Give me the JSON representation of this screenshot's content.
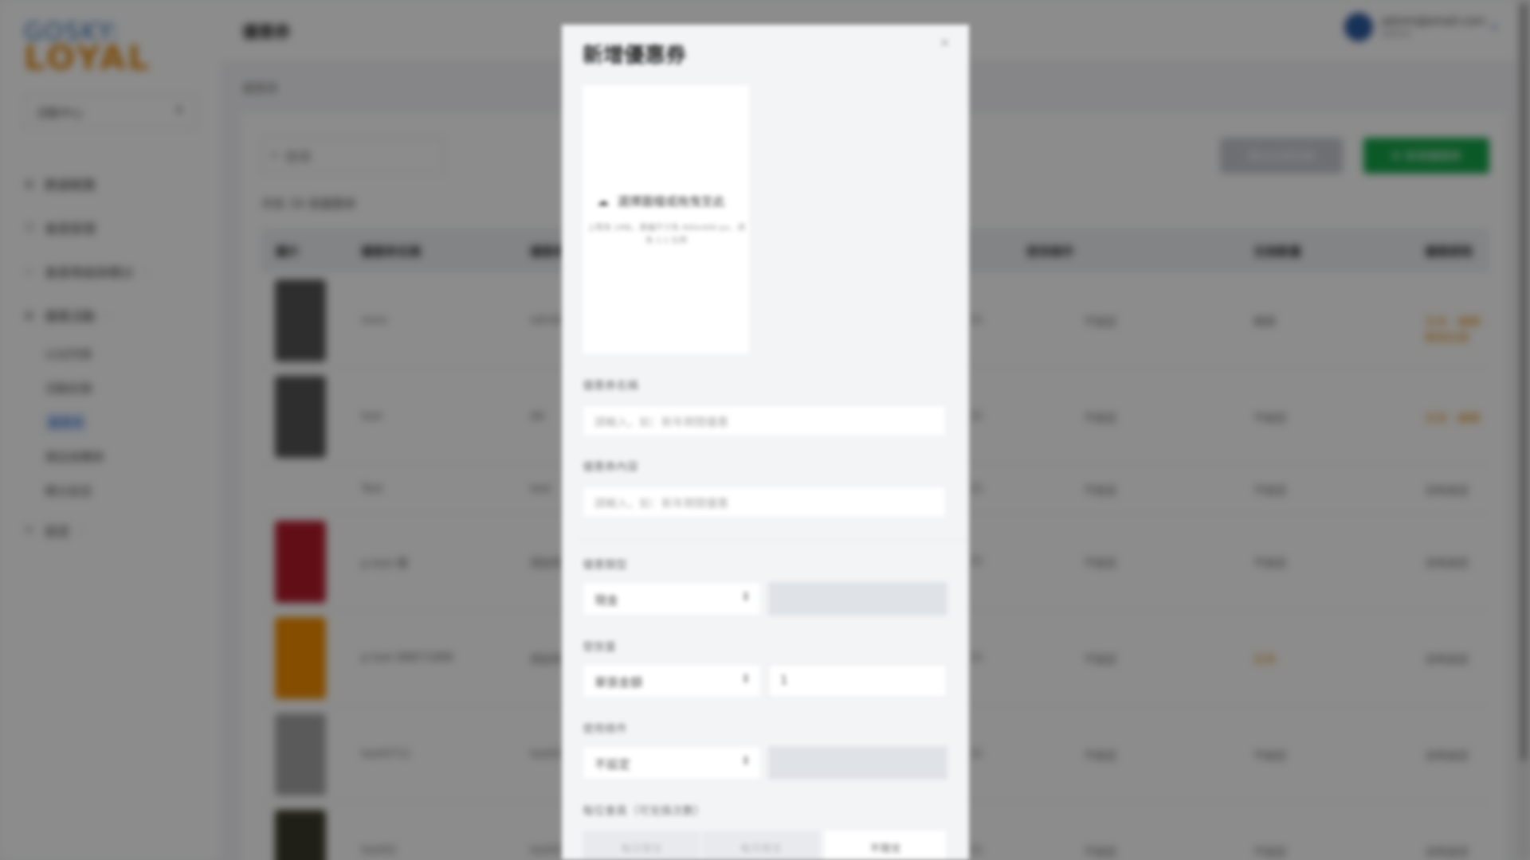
{
  "brand": {
    "logo_top": "GOSKY:",
    "logo_bottom": "LOYAL"
  },
  "sidebar": {
    "store_select": "活動中心",
    "items": [
      {
        "icon": "grid-icon",
        "label": "數據概覽"
      },
      {
        "icon": "users-icon",
        "label": "會員管理"
      },
      {
        "icon": "message-icon",
        "label": "會員等級與積分",
        "chevron": "›"
      },
      {
        "icon": "gift-icon",
        "label": "優惠活動",
        "chevron": "›"
      }
    ],
    "subitems": [
      {
        "label": "以往列表"
      },
      {
        "label": "活動紀錄"
      },
      {
        "label": "優惠券",
        "active": true
      },
      {
        "label": "禮品換購表"
      },
      {
        "label": "積分設定"
      }
    ],
    "settings": {
      "icon": "gear-icon",
      "label": "設定",
      "chevron": "›"
    }
  },
  "header": {
    "title": "優惠券",
    "user": {
      "email": "admin@email.com",
      "role": "Admin",
      "caret": "▾"
    }
  },
  "breadcrumb": "優惠券",
  "toolbar": {
    "search_placeholder": "搜尋",
    "export_label": "匯出全部記錄",
    "add_label": "新增優惠券"
  },
  "table": {
    "count_text": "共有 39 張優惠券",
    "headers": [
      "圖片",
      "優惠券名稱",
      "優惠券",
      "",
      "使用條件",
      "兌換數量",
      "優惠期限"
    ],
    "rows": [
      {
        "thumb": "#555555",
        "name": "xxxx",
        "code": "xdcdcd",
        "date": "21",
        "cond": "不設定",
        "qty": "無限",
        "status": "生效 · 編輯 · 刪除記錄"
      },
      {
        "thumb": "#555555",
        "name": "test",
        "code": "dd",
        "date": "21",
        "cond": "不設定",
        "qty": "不設定",
        "status": "生效 · 編輯"
      },
      {
        "thumb": "",
        "name": "Test",
        "code": "test",
        "date": "21",
        "cond": "不設定",
        "qty": "不設定",
        "status": "沒有設定"
      },
      {
        "thumb": "#b31b2b",
        "name": "p.test 優",
        "code": "測試用",
        "date": "21",
        "cond": "不設定",
        "qty": "不設定",
        "status": "沒有設定"
      },
      {
        "thumb": "#f08c00",
        "name": "p.test 88871888",
        "code": "測試用",
        "date": "21",
        "cond": "不設定",
        "qty": "生效",
        "status": "沒有設定"
      },
      {
        "thumb": "#a5a5a5",
        "name": "test0711",
        "code": "test021",
        "date": "21",
        "cond": "不設定",
        "qty": "不設定",
        "status": "沒有設定"
      },
      {
        "thumb": "#3a3a2a",
        "name": "test02",
        "code": "test01",
        "date": "21",
        "cond": "不設定",
        "qty": "不設定",
        "status": "沒有設定"
      }
    ]
  },
  "modal": {
    "title": "新增優惠券",
    "close": "×",
    "upload_label": "選擇圖檔或拖曳至此",
    "upload_hint": "上限為 1MB，建議尺寸為 400x400 px，須為 1:1 比例",
    "name_label": "優惠券名稱",
    "name_placeholder": "請輸入，如：新年期間優惠",
    "content_label": "優惠券內容",
    "content_placeholder": "請輸入，如：新年期間優惠",
    "type_label": "優惠類型",
    "type_value": "現金",
    "qty_label": "發放量",
    "qty_select": "單張金額",
    "qty_value": "1",
    "cond_label": "使用條件",
    "cond_value": "不設定",
    "limit_label": "每位會員（可兌換次數）",
    "segments": [
      "每日限兌",
      "每月限兌",
      "不限兌"
    ]
  }
}
